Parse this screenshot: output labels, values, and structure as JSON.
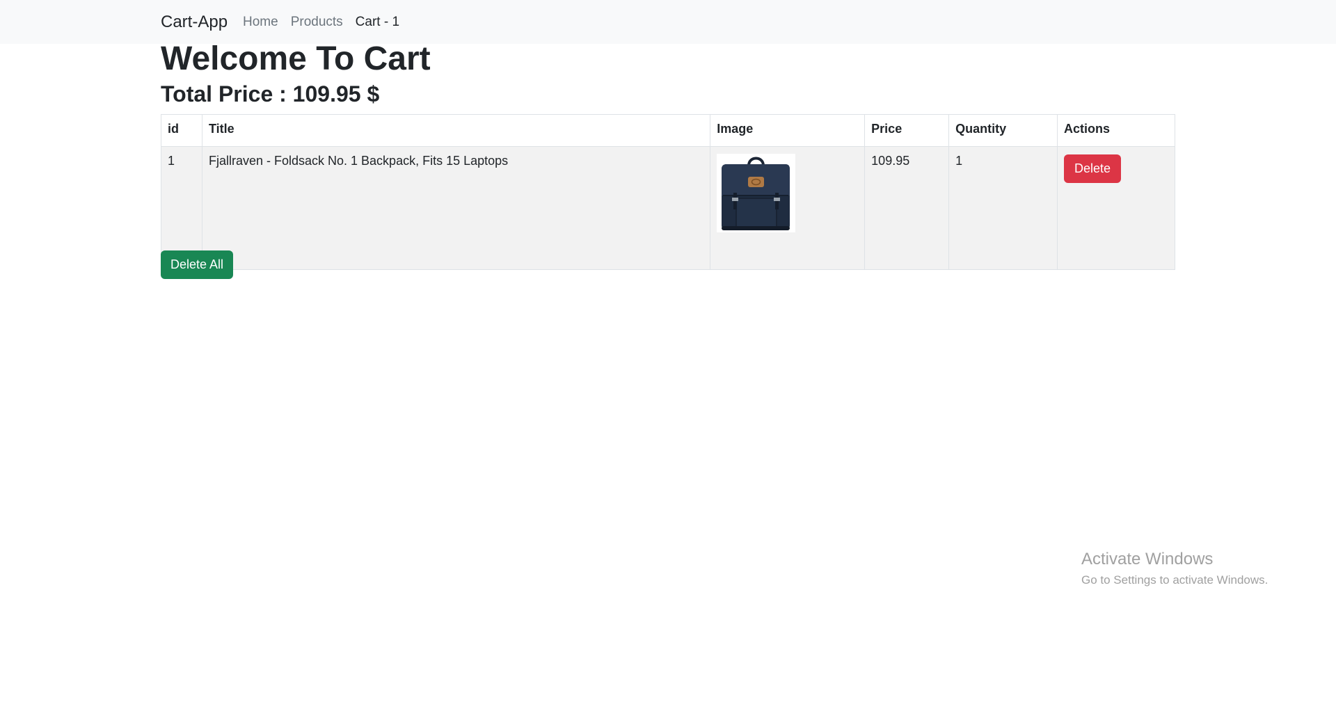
{
  "nav": {
    "brand": "Cart-App",
    "links": [
      {
        "label": "Home"
      },
      {
        "label": "Products"
      },
      {
        "label": "Cart - 1"
      }
    ]
  },
  "page": {
    "title": "Welcome To Cart",
    "total_label": "Total Price : 109.95 $"
  },
  "table": {
    "headers": [
      "id",
      "Title",
      "Image",
      "Price",
      "Quantity",
      "Actions"
    ],
    "rows": [
      {
        "id": "1",
        "title": "Fjallraven - Foldsack No. 1 Backpack, Fits 15 Laptops",
        "image_icon": "backpack-image",
        "price": "109.95",
        "quantity": "1",
        "action_label": "Delete"
      }
    ]
  },
  "actions": {
    "delete_all_label": "Delete All"
  },
  "watermark": {
    "title": "Activate Windows",
    "subtitle": "Go to Settings to activate Windows."
  },
  "colors": {
    "navbar_bg": "#f8f9fa",
    "danger": "#dc3545",
    "success": "#198754",
    "row_bg": "#f2f2f2"
  }
}
